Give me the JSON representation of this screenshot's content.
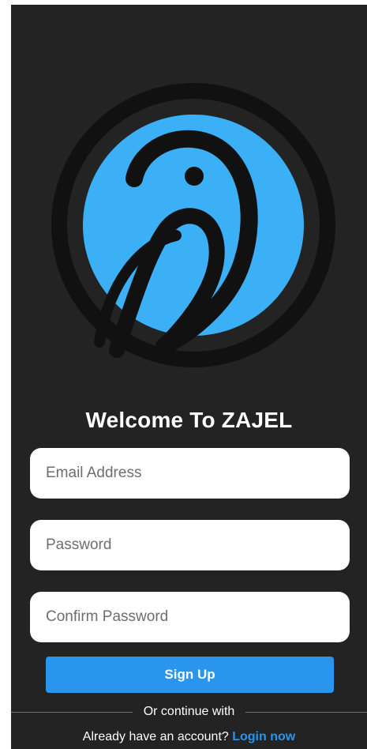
{
  "app": {
    "title": "Welcome To ZAJEL",
    "logo_icon": "bird-logo-icon",
    "accent_color": "#2a95ec",
    "logo_color": "#3bb0f6",
    "background_color": "#232323"
  },
  "form": {
    "email_placeholder": "Email Address",
    "email_value": "",
    "password_placeholder": "Password",
    "password_value": "",
    "confirm_password_placeholder": "Confirm Password",
    "confirm_password_value": "",
    "signup_label": "Sign Up"
  },
  "divider": {
    "label": "Or continue with"
  },
  "footer": {
    "prompt": "Already have an account?",
    "login_label": "Login now"
  }
}
